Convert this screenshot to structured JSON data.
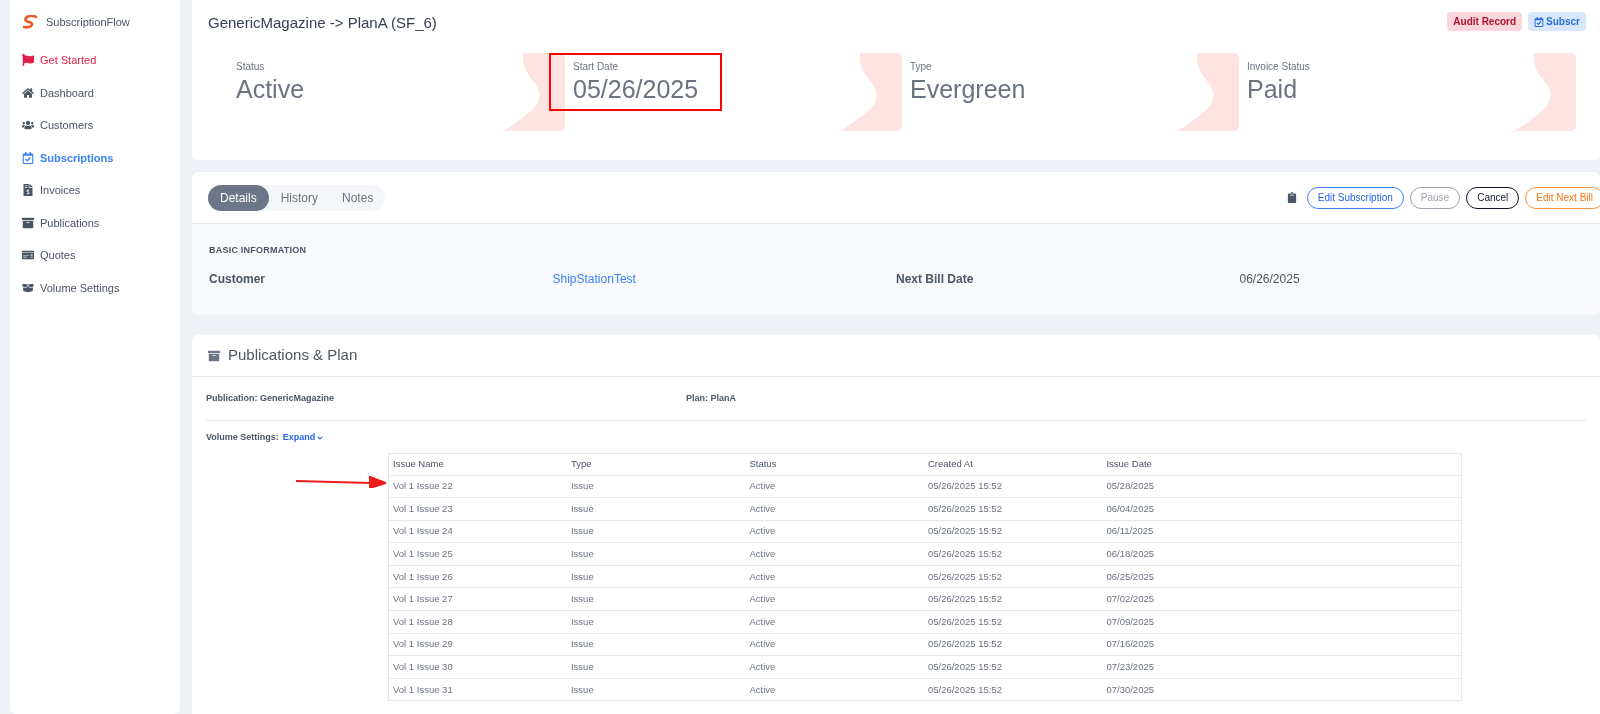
{
  "sidebar": {
    "brand": "SubscriptionFlow",
    "items": [
      {
        "label": "Get Started",
        "selected": false,
        "highlight": true
      },
      {
        "label": "Dashboard",
        "selected": false,
        "highlight": false
      },
      {
        "label": "Customers",
        "selected": false,
        "highlight": false
      },
      {
        "label": "Subscriptions",
        "selected": true,
        "highlight": false
      },
      {
        "label": "Invoices",
        "selected": false,
        "highlight": false
      },
      {
        "label": "Publications",
        "selected": false,
        "highlight": false
      },
      {
        "label": "Quotes",
        "selected": false,
        "highlight": false
      },
      {
        "label": "Volume Settings",
        "selected": false,
        "highlight": false
      }
    ]
  },
  "header": {
    "title": "GenericMagazine -> PlanA (SF_6)",
    "badges": [
      {
        "label": "Audit Record",
        "kind": "audit"
      },
      {
        "label": "Subscr",
        "kind": "subscription"
      }
    ],
    "stats": [
      {
        "label": "Status",
        "value": "Active",
        "highlighted": false
      },
      {
        "label": "Start Date",
        "value": "05/26/2025",
        "highlighted": true
      },
      {
        "label": "Type",
        "value": "Evergreen",
        "highlighted": false
      },
      {
        "label": "Invoice Status",
        "value": "Paid",
        "highlighted": false
      }
    ]
  },
  "details": {
    "tabs": [
      {
        "label": "Details",
        "selected": true
      },
      {
        "label": "History",
        "selected": false
      },
      {
        "label": "Notes",
        "selected": false
      }
    ],
    "actions": [
      {
        "label": "Edit Subscription",
        "kind": "primary"
      },
      {
        "label": "Pause",
        "kind": "muted"
      },
      {
        "label": "Cancel",
        "kind": "dark"
      },
      {
        "label": "Edit Next Bill",
        "kind": "warning"
      }
    ],
    "section": "BASIC INFORMATION",
    "fields": [
      {
        "label": "Customer",
        "value": "ShipStationTest",
        "link": true
      },
      {
        "label": "Next Bill Date",
        "value": "06/26/2025",
        "link": false
      }
    ]
  },
  "publications": {
    "title": "Publications & Plan",
    "publication": "Publication: GenericMagazine",
    "plan": "Plan: PlanA",
    "volume_label": "Volume Settings:",
    "expand": "Expand",
    "table": {
      "columns": [
        "Issue Name",
        "Type",
        "Status",
        "Created At",
        "Issue Date"
      ],
      "rows": [
        [
          "Vol 1 Issue 22",
          "Issue",
          "Active",
          "05/26/2025 15:52",
          "05/28/2025"
        ],
        [
          "Vol 1 Issue 23",
          "Issue",
          "Active",
          "05/26/2025 15:52",
          "06/04/2025"
        ],
        [
          "Vol 1 Issue 24",
          "Issue",
          "Active",
          "05/26/2025 15:52",
          "06/11/2025"
        ],
        [
          "Vol 1 Issue 25",
          "Issue",
          "Active",
          "05/26/2025 15:52",
          "06/18/2025"
        ],
        [
          "Vol 1 Issue 26",
          "Issue",
          "Active",
          "05/26/2025 15:52",
          "06/25/2025"
        ],
        [
          "Vol 1 Issue 27",
          "Issue",
          "Active",
          "05/26/2025 15:52",
          "07/02/2025"
        ],
        [
          "Vol 1 Issue 28",
          "Issue",
          "Active",
          "05/26/2025 15:52",
          "07/09/2025"
        ],
        [
          "Vol 1 Issue 29",
          "Issue",
          "Active",
          "05/26/2025 15:52",
          "07/16/2025"
        ],
        [
          "Vol 1 Issue 30",
          "Issue",
          "Active",
          "05/26/2025 15:52",
          "07/23/2025"
        ],
        [
          "Vol 1 Issue 31",
          "Issue",
          "Active",
          "05/26/2025 15:52",
          "07/30/2025"
        ]
      ]
    }
  }
}
